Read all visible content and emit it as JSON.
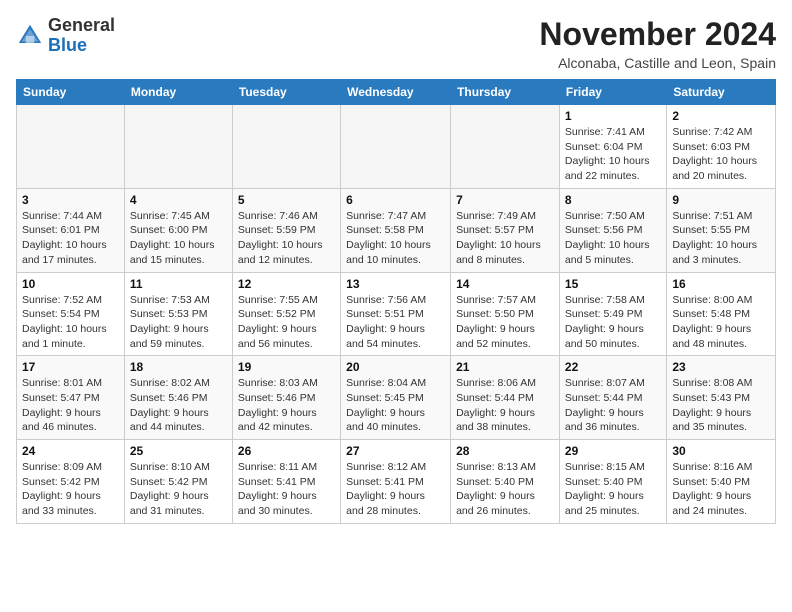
{
  "header": {
    "logo_general": "General",
    "logo_blue": "Blue",
    "month_title": "November 2024",
    "location": "Alconaba, Castille and Leon, Spain"
  },
  "weekdays": [
    "Sunday",
    "Monday",
    "Tuesday",
    "Wednesday",
    "Thursday",
    "Friday",
    "Saturday"
  ],
  "weeks": [
    [
      {
        "day": null
      },
      {
        "day": null
      },
      {
        "day": null
      },
      {
        "day": null
      },
      {
        "day": null
      },
      {
        "day": 1,
        "sunrise": "7:41 AM",
        "sunset": "6:04 PM",
        "daylight": "10 hours and 22 minutes."
      },
      {
        "day": 2,
        "sunrise": "7:42 AM",
        "sunset": "6:03 PM",
        "daylight": "10 hours and 20 minutes."
      }
    ],
    [
      {
        "day": 3,
        "sunrise": "7:44 AM",
        "sunset": "6:01 PM",
        "daylight": "10 hours and 17 minutes."
      },
      {
        "day": 4,
        "sunrise": "7:45 AM",
        "sunset": "6:00 PM",
        "daylight": "10 hours and 15 minutes."
      },
      {
        "day": 5,
        "sunrise": "7:46 AM",
        "sunset": "5:59 PM",
        "daylight": "10 hours and 12 minutes."
      },
      {
        "day": 6,
        "sunrise": "7:47 AM",
        "sunset": "5:58 PM",
        "daylight": "10 hours and 10 minutes."
      },
      {
        "day": 7,
        "sunrise": "7:49 AM",
        "sunset": "5:57 PM",
        "daylight": "10 hours and 8 minutes."
      },
      {
        "day": 8,
        "sunrise": "7:50 AM",
        "sunset": "5:56 PM",
        "daylight": "10 hours and 5 minutes."
      },
      {
        "day": 9,
        "sunrise": "7:51 AM",
        "sunset": "5:55 PM",
        "daylight": "10 hours and 3 minutes."
      }
    ],
    [
      {
        "day": 10,
        "sunrise": "7:52 AM",
        "sunset": "5:54 PM",
        "daylight": "10 hours and 1 minute."
      },
      {
        "day": 11,
        "sunrise": "7:53 AM",
        "sunset": "5:53 PM",
        "daylight": "9 hours and 59 minutes."
      },
      {
        "day": 12,
        "sunrise": "7:55 AM",
        "sunset": "5:52 PM",
        "daylight": "9 hours and 56 minutes."
      },
      {
        "day": 13,
        "sunrise": "7:56 AM",
        "sunset": "5:51 PM",
        "daylight": "9 hours and 54 minutes."
      },
      {
        "day": 14,
        "sunrise": "7:57 AM",
        "sunset": "5:50 PM",
        "daylight": "9 hours and 52 minutes."
      },
      {
        "day": 15,
        "sunrise": "7:58 AM",
        "sunset": "5:49 PM",
        "daylight": "9 hours and 50 minutes."
      },
      {
        "day": 16,
        "sunrise": "8:00 AM",
        "sunset": "5:48 PM",
        "daylight": "9 hours and 48 minutes."
      }
    ],
    [
      {
        "day": 17,
        "sunrise": "8:01 AM",
        "sunset": "5:47 PM",
        "daylight": "9 hours and 46 minutes."
      },
      {
        "day": 18,
        "sunrise": "8:02 AM",
        "sunset": "5:46 PM",
        "daylight": "9 hours and 44 minutes."
      },
      {
        "day": 19,
        "sunrise": "8:03 AM",
        "sunset": "5:46 PM",
        "daylight": "9 hours and 42 minutes."
      },
      {
        "day": 20,
        "sunrise": "8:04 AM",
        "sunset": "5:45 PM",
        "daylight": "9 hours and 40 minutes."
      },
      {
        "day": 21,
        "sunrise": "8:06 AM",
        "sunset": "5:44 PM",
        "daylight": "9 hours and 38 minutes."
      },
      {
        "day": 22,
        "sunrise": "8:07 AM",
        "sunset": "5:44 PM",
        "daylight": "9 hours and 36 minutes."
      },
      {
        "day": 23,
        "sunrise": "8:08 AM",
        "sunset": "5:43 PM",
        "daylight": "9 hours and 35 minutes."
      }
    ],
    [
      {
        "day": 24,
        "sunrise": "8:09 AM",
        "sunset": "5:42 PM",
        "daylight": "9 hours and 33 minutes."
      },
      {
        "day": 25,
        "sunrise": "8:10 AM",
        "sunset": "5:42 PM",
        "daylight": "9 hours and 31 minutes."
      },
      {
        "day": 26,
        "sunrise": "8:11 AM",
        "sunset": "5:41 PM",
        "daylight": "9 hours and 30 minutes."
      },
      {
        "day": 27,
        "sunrise": "8:12 AM",
        "sunset": "5:41 PM",
        "daylight": "9 hours and 28 minutes."
      },
      {
        "day": 28,
        "sunrise": "8:13 AM",
        "sunset": "5:40 PM",
        "daylight": "9 hours and 26 minutes."
      },
      {
        "day": 29,
        "sunrise": "8:15 AM",
        "sunset": "5:40 PM",
        "daylight": "9 hours and 25 minutes."
      },
      {
        "day": 30,
        "sunrise": "8:16 AM",
        "sunset": "5:40 PM",
        "daylight": "9 hours and 24 minutes."
      }
    ]
  ]
}
